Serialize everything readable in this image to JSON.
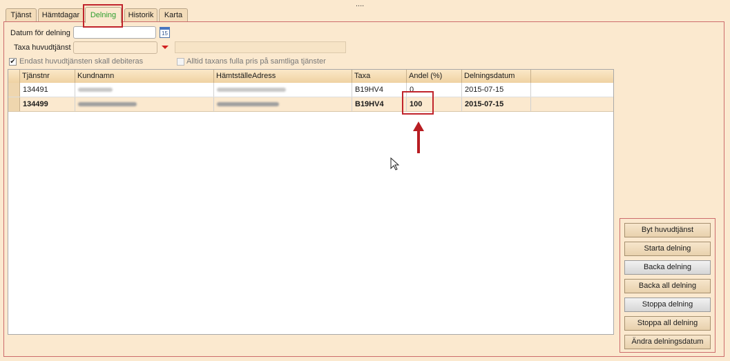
{
  "tabs": [
    {
      "label": "Tjänst"
    },
    {
      "label": "Hämtdagar"
    },
    {
      "label": "Delning"
    },
    {
      "label": "Historik"
    },
    {
      "label": "Karta"
    }
  ],
  "active_tab": "Delning",
  "form": {
    "datum_label": "Datum för delning",
    "datum_value": "",
    "calendar_day": "15",
    "taxa_label": "Taxa huvudtjänst",
    "taxa_value": "",
    "taxa_extra": "",
    "chk_endast_label": "Endast huvudtjänsten skall debiteras",
    "chk_endast_checked": true,
    "chk_alltid_label": "Alltid taxans fulla pris på samtliga tjänster",
    "chk_alltid_checked": false
  },
  "grid": {
    "columns": [
      "Tjänstnr",
      "Kundnamn",
      "HämtställeAdress",
      "Taxa",
      "Andel (%)",
      "Delningsdatum"
    ],
    "rows": [
      {
        "tjanstnr": "134491",
        "taxa": "B19HV4",
        "andel": "0",
        "datum": "2015-07-15"
      },
      {
        "tjanstnr": "134499",
        "taxa": "B19HV4",
        "andel": "100",
        "datum": "2015-07-15"
      }
    ]
  },
  "buttons": {
    "byt": "Byt huvudtjänst",
    "starta": "Starta delning",
    "backa": "Backa delning",
    "backa_all": "Backa all delning",
    "stoppa": "Stoppa delning",
    "stoppa_all": "Stoppa all delning",
    "andra": "Ändra delningsdatum"
  },
  "colors": {
    "background": "#fbe9cf",
    "highlight": "#c0232b",
    "active_tab_text": "#2e9e2e"
  }
}
